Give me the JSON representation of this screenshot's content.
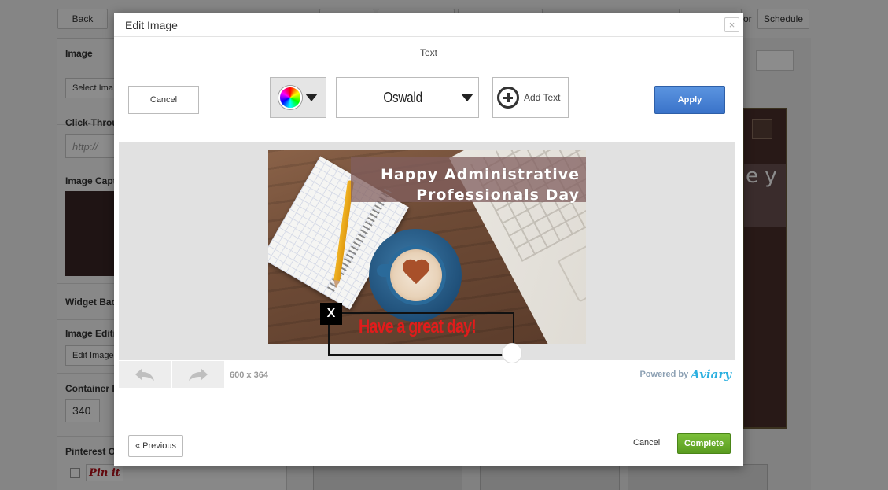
{
  "background": {
    "back_label": "Back",
    "schedule_label": "Schedule",
    "or_label": "or",
    "sections": [
      {
        "label": "Image",
        "input": "Select Ima"
      },
      {
        "label": "Click-Throu",
        "input": "http://"
      },
      {
        "label": "Image Capt"
      },
      {
        "label": "Widget Bac"
      },
      {
        "label": "Image Editi",
        "input": "Edit Image"
      },
      {
        "label": "Container I",
        "input": "340"
      },
      {
        "label": "Pinterest O",
        "input": "Pin it"
      }
    ],
    "photo_text": "e y"
  },
  "modal": {
    "title": "Edit Image",
    "close_glyph": "×",
    "tool_title": "Text",
    "cancel_label": "Cancel",
    "font_name": "Oswald",
    "add_text_label": "Add Text",
    "apply_label": "Apply",
    "image": {
      "banner_line1": "Happy Administrative",
      "banner_line2": "Professionals Day",
      "overlay_text": "Have a great day!",
      "close_glyph": "X"
    },
    "dimensions": "600 x 364",
    "powered_by": "Powered by",
    "brand": "Aviary",
    "previous_label": "« Previous",
    "footer_cancel_label": "Cancel",
    "complete_label": "Complete"
  },
  "colors": {
    "apply": "#3a73c9",
    "complete": "#5a9c20",
    "text_color": "#e01c1c",
    "aviary": "#2bb0e0"
  },
  "icons": [
    "color-wheel-icon",
    "dropdown-arrow-icon",
    "add-circle-icon",
    "undo-icon",
    "redo-icon",
    "close-icon"
  ]
}
